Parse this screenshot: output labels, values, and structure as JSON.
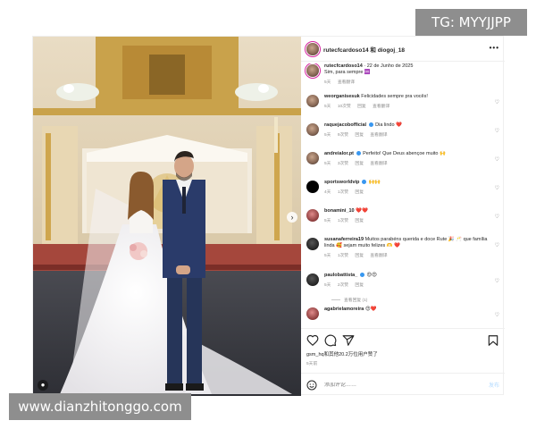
{
  "watermarks": {
    "top_right": "TG: MYYJJPP",
    "bottom_left": "www.dianzhitonggo.com"
  },
  "post": {
    "header": {
      "author": "rutecfcardoso14",
      "coauthor": "diogoj_18",
      "joiner": "和",
      "more": "•••"
    },
    "caption": {
      "user": "rutecfcardoso14",
      "date": "22 de Junho de 2025",
      "text": "Sim, para sempre ♾️",
      "age": "5天",
      "translate": "查看翻译"
    },
    "comments": [
      {
        "user": "weorganisesuk",
        "verified": false,
        "text": "Felicidades sempre pra vocês!",
        "age": "5天",
        "likes": "10次赞",
        "reply": "回复",
        "translate": "查看翻译"
      },
      {
        "user": "raquejacobofficial",
        "verified": true,
        "text": "Dia lindo ❤️",
        "age": "5天",
        "likes": "9次赞",
        "reply": "回复",
        "translate": "查看翻译"
      },
      {
        "user": "andreialor.pt",
        "verified": true,
        "text": "Perfeito! Que Deus abençoe muito 🙌",
        "age": "5天",
        "likes": "3次赞",
        "reply": "回复",
        "translate": "查看翻译"
      },
      {
        "user": "sportsworldvip",
        "verified": true,
        "text": "🙌🙌",
        "age": "4天",
        "likes": "1次赞",
        "reply": "回复",
        "translate": "",
        "avatar": "black"
      },
      {
        "user": "bonamini_10",
        "verified": false,
        "text": "❤️❤️",
        "age": "5天",
        "likes": "1次赞",
        "reply": "回复",
        "translate": "",
        "avatar": "red"
      },
      {
        "user": "susanaferreira19",
        "verified": false,
        "text": "Muitos parabéns querida e doce Rute 🎉 🥂 que família linda 🥰 sejam muito felizes 🫶 ❤️",
        "age": "5天",
        "likes": "1次赞",
        "reply": "回复",
        "translate": "查看翻译",
        "avatar": "dark"
      },
      {
        "user": "paulobattista_",
        "verified": true,
        "text": "😍😍",
        "age": "5天",
        "likes": "2次赞",
        "reply": "回复",
        "translate": "",
        "avatar": "dark"
      }
    ],
    "view_replies": "查看回复 (1)",
    "last_comment": {
      "user": "agabrielamoreira",
      "text": "😍❤️"
    },
    "likes_text": "gsm_hq和其他20.2万位用户赞了",
    "post_age": "5天前",
    "add_comment_placeholder": "添加评论……",
    "send_label": "发布"
  },
  "colors": {
    "accent_blue": "#3897f0",
    "heart_red": "#ed4956",
    "muted_text": "#8e8e8e",
    "watermark_bg": "#8e8e8e"
  },
  "icons": [
    "heart-icon",
    "comment-icon",
    "share-icon",
    "bookmark-icon",
    "smile-icon",
    "more-icon",
    "next-arrow-icon",
    "tagged-user-icon"
  ]
}
